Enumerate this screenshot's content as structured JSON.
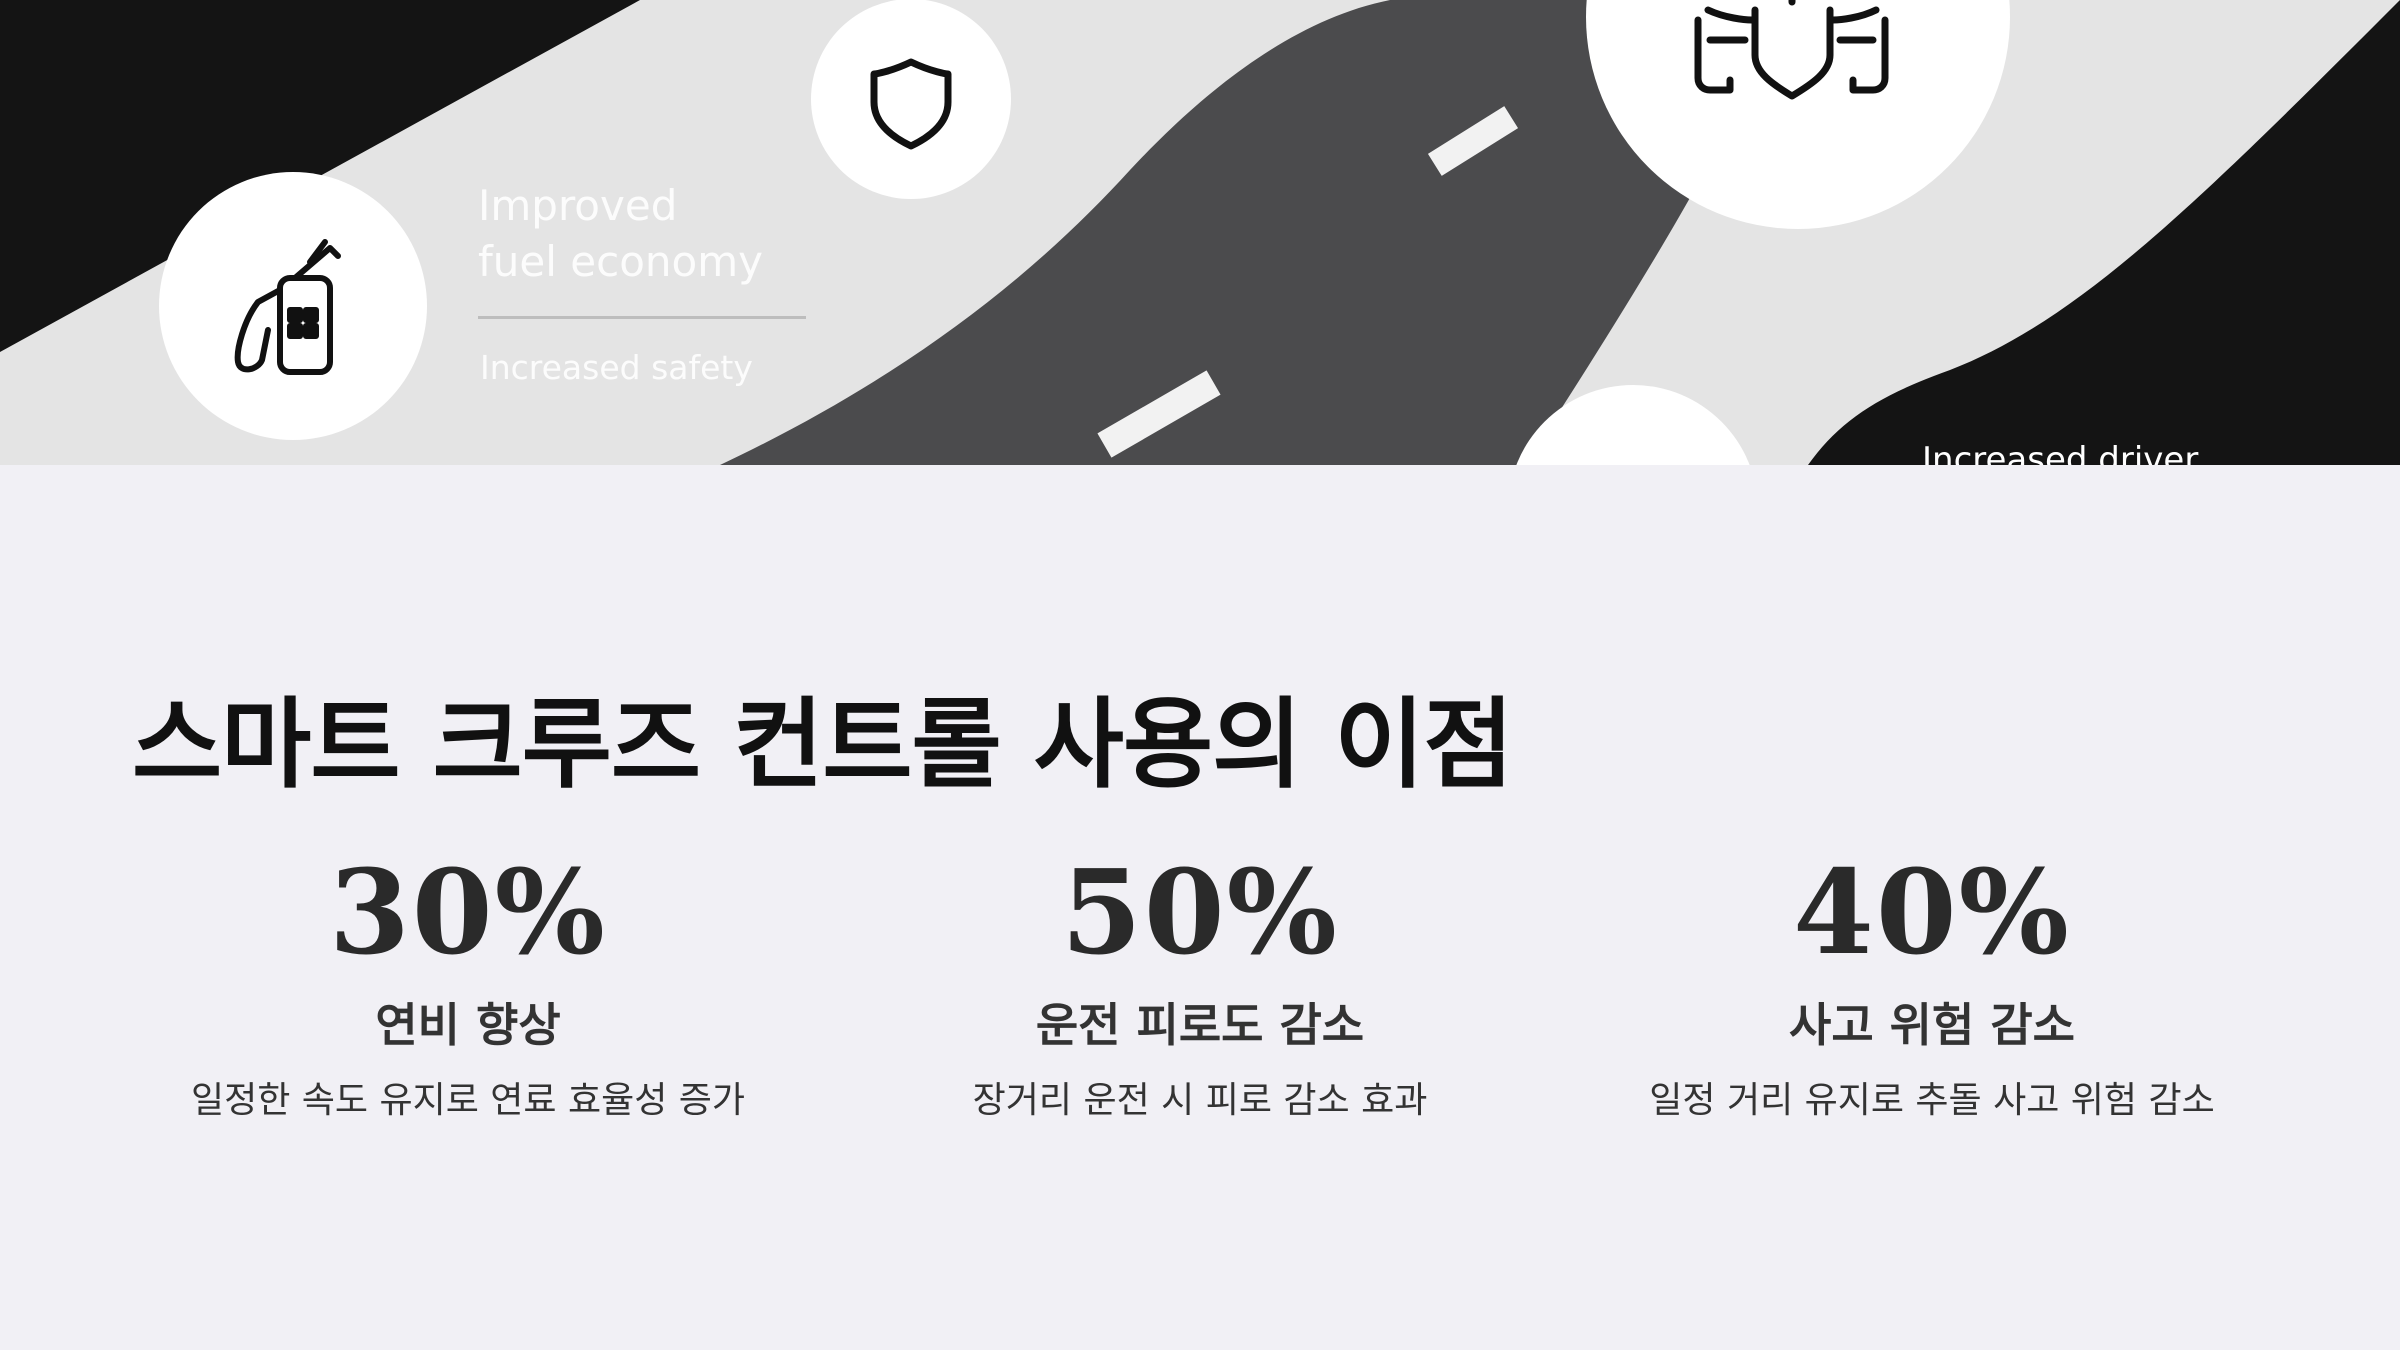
{
  "hero": {
    "improved_line1": "Improved",
    "improved_line2": "fuel economy",
    "increased_safety": "Increased safety",
    "increased_driver": "Increased driver",
    "icons": [
      "fuel-pump-icon",
      "shield-icon",
      "car-shield-icon"
    ]
  },
  "section": {
    "title": "스마트 크루즈 컨트롤 사용의 이점",
    "stats": [
      {
        "value": "30%",
        "label": "연비 향상",
        "description": "일정한 속도 유지로 연료 효율성 증가"
      },
      {
        "value": "50%",
        "label": "운전 피로도 감소",
        "description": "장거리 운전 시 피로 감소 효과"
      },
      {
        "value": "40%",
        "label": "사고 위험 감소",
        "description": "일정 거리 유지로 추돌 사고 위험 감소"
      }
    ]
  },
  "colors": {
    "background": "#f1f0f5",
    "road": "#4b4b4d",
    "dark": "#141414",
    "light_band": "#e4e4e4",
    "text": "#111111"
  }
}
